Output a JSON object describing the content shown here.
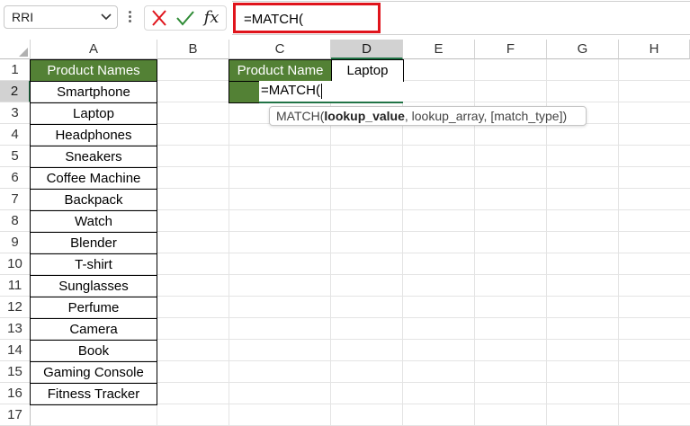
{
  "formula_bar": {
    "name_box": "RRI",
    "formula": "=MATCH(",
    "highlight_color": "#e0141c"
  },
  "columns": [
    "A",
    "B",
    "C",
    "D",
    "E",
    "F",
    "G",
    "H"
  ],
  "active_column": "D",
  "rows": [
    "1",
    "2",
    "3",
    "4",
    "5",
    "6",
    "7",
    "8",
    "9",
    "10",
    "11",
    "12",
    "13",
    "14",
    "15",
    "16",
    "17"
  ],
  "active_row": "2",
  "cells": {
    "A1": "Product Names",
    "A_values": [
      "Smartphone",
      "Laptop",
      "Headphones",
      "Sneakers",
      "Coffee Machine",
      "Backpack",
      "Watch",
      "Blender",
      "T-shirt",
      "Sunglasses",
      "Perfume",
      "Camera",
      "Book",
      "Gaming Console",
      "Fitness Tracker"
    ],
    "C1": "Product Name",
    "D1": "Laptop",
    "C2": "=MATCH("
  },
  "tooltip": {
    "func": "MATCH(",
    "arg1": "lookup_value",
    "rest": ", lookup_array, [match_type])"
  },
  "colors": {
    "header_green": "#538135",
    "active_green": "#217346"
  }
}
